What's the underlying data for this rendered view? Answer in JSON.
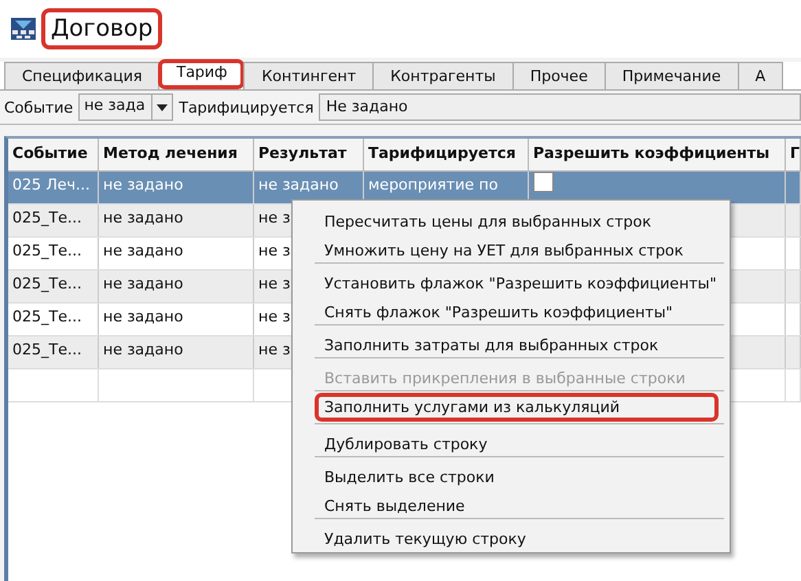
{
  "window": {
    "title": "Договор",
    "highlighted": true
  },
  "tabs": [
    {
      "label": "Спецификация",
      "selected": false,
      "highlighted": false
    },
    {
      "label": "Тариф",
      "selected": true,
      "highlighted": true
    },
    {
      "label": "Контингент",
      "selected": false,
      "highlighted": false
    },
    {
      "label": "Контрагенты",
      "selected": false,
      "highlighted": false
    },
    {
      "label": "Прочее",
      "selected": false,
      "highlighted": false
    },
    {
      "label": "Примечание",
      "selected": false,
      "highlighted": false
    },
    {
      "label": "А",
      "selected": false,
      "highlighted": false
    }
  ],
  "filter": {
    "event_label": "Событие",
    "event_value": "не зада",
    "tariff_label": "Тарифицируется",
    "tariff_value": "Не задано"
  },
  "table": {
    "columns": [
      "Событие",
      "Метод лечения",
      "Результат",
      "Тарифицируется",
      "Разрешить коэффициенты",
      "Г"
    ],
    "rows": [
      {
        "selected": true,
        "cells": [
          "025 Леч...",
          "не задано",
          "не задано",
          "мероприятие по"
        ],
        "coefficients_checked": false
      },
      {
        "selected": false,
        "cells": [
          "025_Те...",
          "не задано",
          "не з"
        ]
      },
      {
        "selected": false,
        "cells": [
          "025_Те...",
          "не задано",
          "не з"
        ]
      },
      {
        "selected": false,
        "cells": [
          "025_Те...",
          "не задано",
          "не з"
        ]
      },
      {
        "selected": false,
        "cells": [
          "025_Те...",
          "не задано",
          "не з"
        ]
      },
      {
        "selected": false,
        "cells": [
          "025_Те...",
          "не задано",
          "не з"
        ]
      }
    ]
  },
  "context_menu": [
    {
      "kind": "item",
      "label": "Пересчитать цены для выбранных строк",
      "disabled": false,
      "highlighted": false
    },
    {
      "kind": "item",
      "label": "Умножить цену на УЕТ для выбранных строк",
      "disabled": false,
      "highlighted": false
    },
    {
      "kind": "separator"
    },
    {
      "kind": "item",
      "label": "Установить флажок \"Разрешить коэффициенты\"",
      "disabled": false,
      "highlighted": false
    },
    {
      "kind": "item",
      "label": "Снять флажок \"Разрешить коэффициенты\"",
      "disabled": false,
      "highlighted": false
    },
    {
      "kind": "separator"
    },
    {
      "kind": "item",
      "label": "Заполнить затраты для выбранных строк",
      "disabled": false,
      "highlighted": false
    },
    {
      "kind": "separator"
    },
    {
      "kind": "item",
      "label": "Вставить прикрепления в выбранные строки",
      "disabled": true,
      "highlighted": false
    },
    {
      "kind": "separator"
    },
    {
      "kind": "item",
      "label": "Заполнить услугами из калькуляций",
      "disabled": false,
      "highlighted": true
    },
    {
      "kind": "separator"
    },
    {
      "kind": "item",
      "label": "Дублировать строку",
      "disabled": false,
      "highlighted": false
    },
    {
      "kind": "separator"
    },
    {
      "kind": "item",
      "label": "Выделить все строки",
      "disabled": false,
      "highlighted": false
    },
    {
      "kind": "item",
      "label": "Снять выделение",
      "disabled": false,
      "highlighted": false
    },
    {
      "kind": "separator"
    },
    {
      "kind": "item",
      "label": "Удалить текущую строку",
      "disabled": false,
      "highlighted": false
    }
  ]
}
